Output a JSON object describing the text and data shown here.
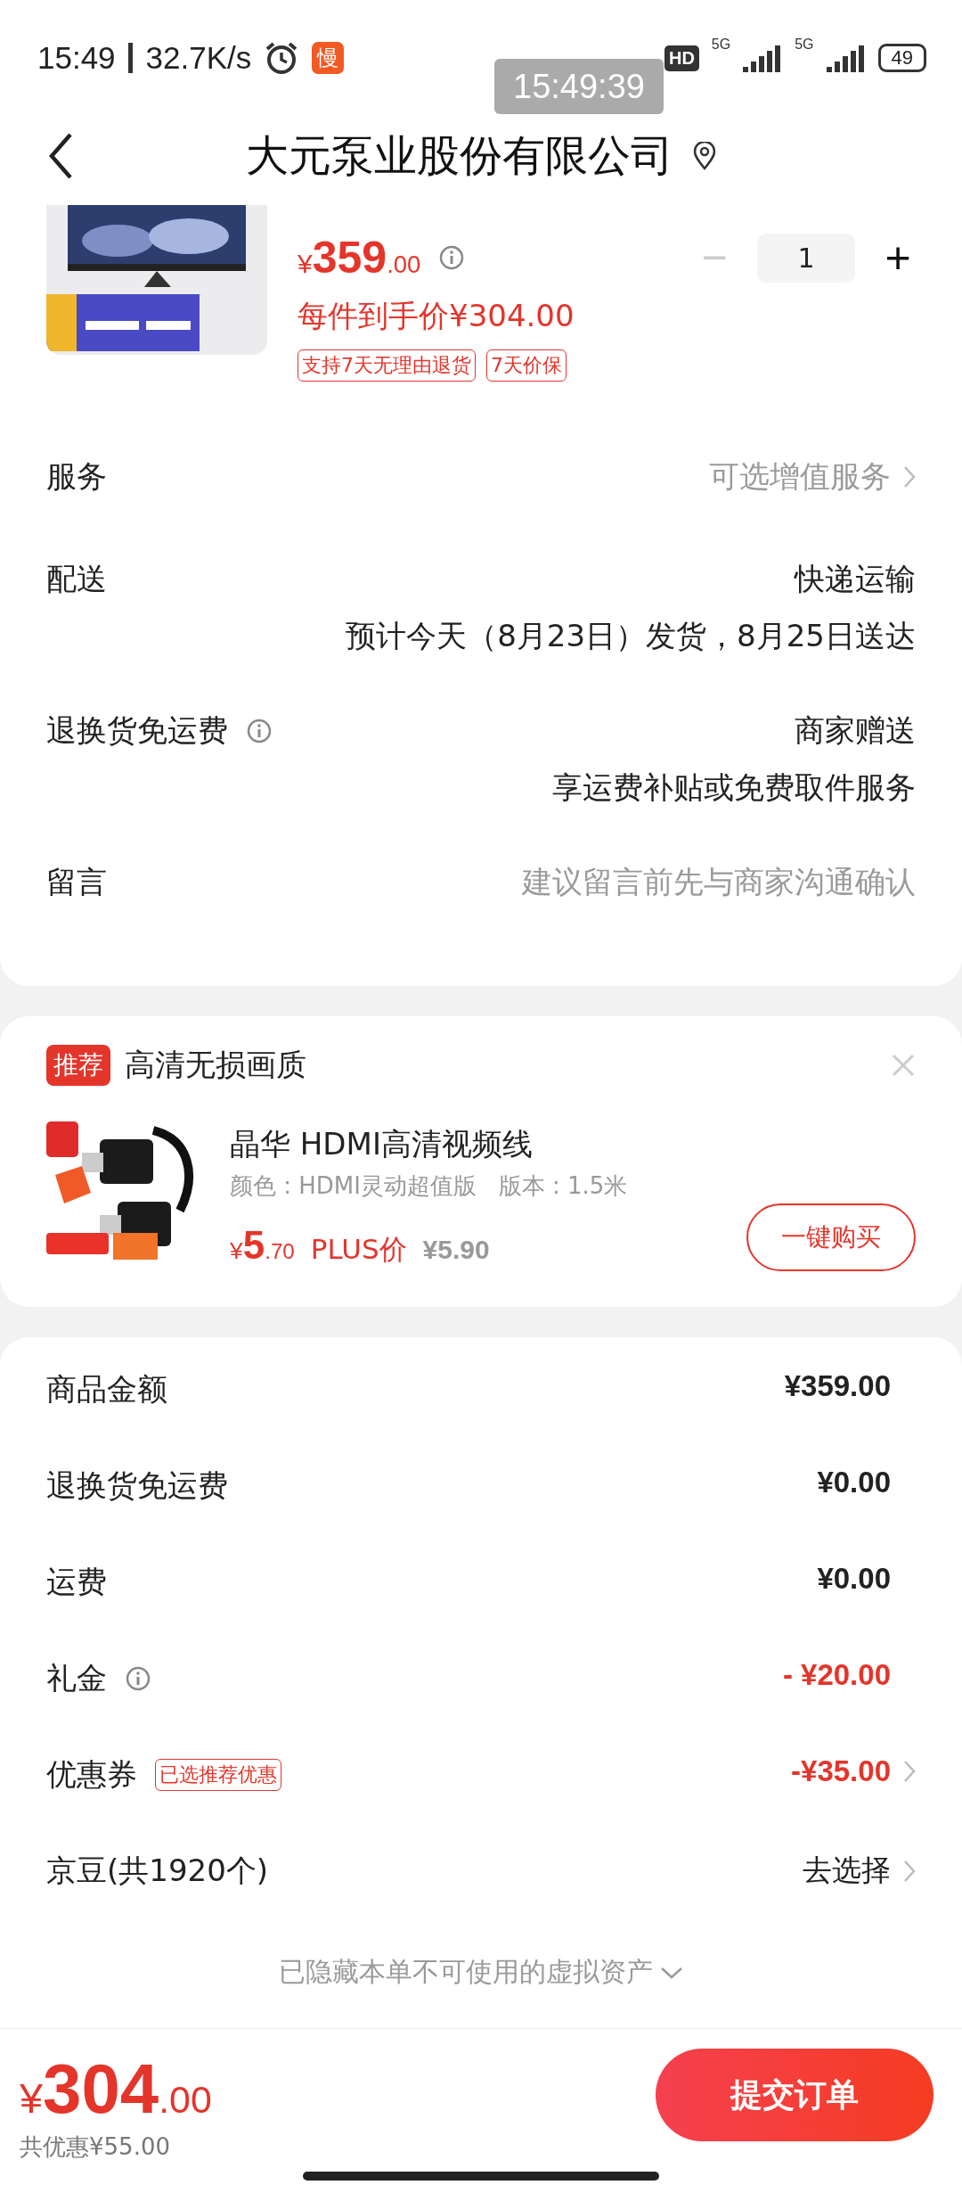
{
  "status_bar": {
    "time": "15:49",
    "speed": "32.7K/s",
    "app_badge": "慢",
    "hd": "HD",
    "net1": "5G",
    "net2": "5G",
    "battery": "49"
  },
  "clock_overlay": "15:49:39",
  "header": {
    "title": "大元泵业股份有限公司"
  },
  "product": {
    "price_symbol": "¥",
    "price_int": "359",
    "price_dec": ".00",
    "quantity": "1",
    "minus": "−",
    "plus": "+",
    "minus_disabled": true,
    "final_price": "每件到手价¥304.00",
    "tags": [
      "支持7天无理由退货",
      "7天价保"
    ]
  },
  "order_rows": [
    {
      "label": "服务",
      "info": false,
      "value": "可选增值服务",
      "muted": true,
      "chevron": true
    },
    {
      "label": "配送",
      "info": false,
      "value": "快递运输",
      "detail": "预计今天（8月23日）发货，8月25日送达",
      "muted": false,
      "chevron": false
    },
    {
      "label": "退换货免运费",
      "info": true,
      "value": "商家赠送",
      "detail": "享运费补贴或免费取件服务",
      "muted": false,
      "chevron": false
    },
    {
      "label": "留言",
      "info": false,
      "value": "建议留言前先与商家沟通确认",
      "muted": true,
      "chevron": false
    }
  ],
  "recommend": {
    "badge": "推荐",
    "title": "高清无损画质",
    "item": {
      "name": "晶华 HDMI高清视频线",
      "spec": "颜色 : HDMI灵动超值版   版本 : 1.5米",
      "price_symbol": "¥",
      "price_int": "5",
      "price_dec": ".70",
      "plus_label": "PLUS价",
      "original": "¥5.90",
      "button": "一键购买"
    }
  },
  "summary_rows": [
    {
      "label": "商品金额",
      "info": false,
      "value": "¥359.00",
      "kind": "amount",
      "chevron": false
    },
    {
      "label": "退换货免运费",
      "info": false,
      "value": "¥0.00",
      "kind": "amount",
      "chevron": false
    },
    {
      "label": "运费",
      "info": false,
      "value": "¥0.00",
      "kind": "amount",
      "chevron": false
    },
    {
      "label": "礼金",
      "info": true,
      "value": "- ¥20.00",
      "kind": "discount",
      "chevron": false
    },
    {
      "label": "优惠券",
      "info": false,
      "tag": "已选推荐优惠",
      "value": "-¥35.00",
      "kind": "discount",
      "chevron": true
    },
    {
      "label": "京豆(共1920个)",
      "info": false,
      "value": "去选择",
      "kind": "action",
      "chevron": true
    }
  ],
  "hidden_note": "已隐藏本单不可使用的虚拟资产",
  "footer": {
    "price_symbol": "¥",
    "price_int": "304",
    "price_dec": ".00",
    "saving": "共优惠¥55.00",
    "submit": "提交订单"
  }
}
